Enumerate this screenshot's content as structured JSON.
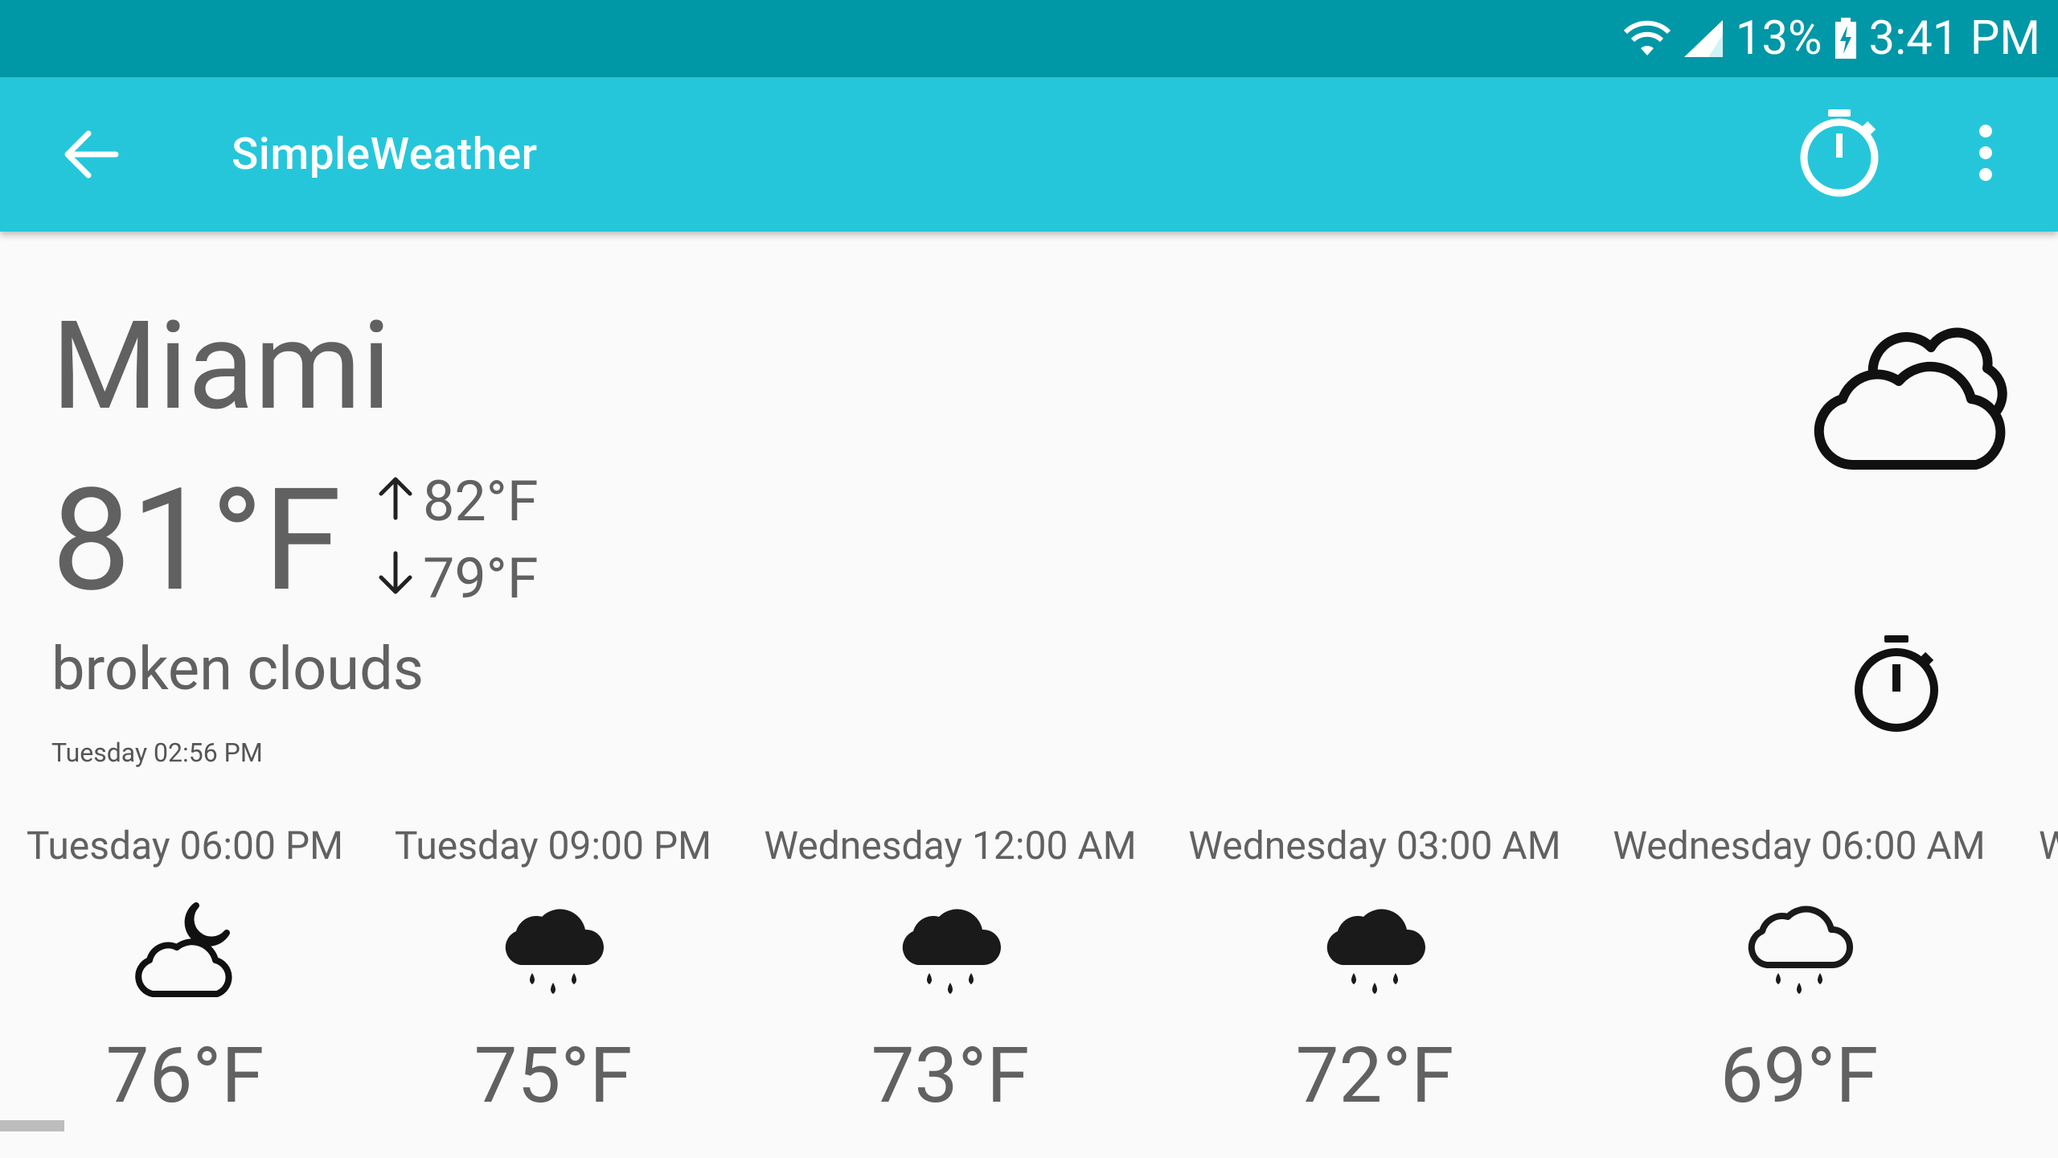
{
  "status_bar": {
    "battery": "13%",
    "time": "3:41 PM"
  },
  "app_bar": {
    "title": "SimpleWeather"
  },
  "current": {
    "city": "Miami",
    "temperature": "81°F",
    "high": "82°F",
    "low": "79°F",
    "description": "broken clouds",
    "updated": "Tuesday 02:56 PM"
  },
  "forecast": [
    {
      "time": "Tuesday 06:00 PM",
      "temp": "76°F",
      "icon": "cloud-moon-icon"
    },
    {
      "time": "Tuesday 09:00 PM",
      "temp": "75°F",
      "icon": "rain-cloud-icon"
    },
    {
      "time": "Wednesday 12:00 AM",
      "temp": "73°F",
      "icon": "rain-cloud-icon"
    },
    {
      "time": "Wednesday 03:00 AM",
      "temp": "72°F",
      "icon": "rain-cloud-icon"
    },
    {
      "time": "Wednesday 06:00 AM",
      "temp": "69°F",
      "icon": "light-rain-cloud-icon"
    },
    {
      "time": "W"
    }
  ],
  "colors": {
    "status_bar": "#0097a7",
    "app_bar": "#26c6da",
    "text": "#616161"
  }
}
